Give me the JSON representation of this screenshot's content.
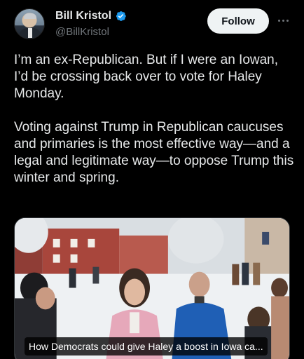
{
  "author": {
    "display_name": "Bill Kristol",
    "handle": "@BillKristol",
    "verified": true,
    "verified_color": "#1d9bf0",
    "avatar_icon": "profile-photo"
  },
  "actions": {
    "follow_label": "Follow",
    "more_icon": "ellipsis-icon"
  },
  "tweet": {
    "paragraphs": [
      "I’m an ex-Republican. But if I were an Iowan, I’d be crossing back over to vote for Haley Monday.",
      "Voting against Trump in Republican caucuses and primaries is the most effective way—and a legal and legitimate way—to oppose Trump this winter and spring."
    ]
  },
  "media": {
    "caption": "How Democrats could give Haley a boost in Iowa ca..."
  },
  "colors": {
    "background": "#000000",
    "text": "#e7e9ea",
    "secondary_text": "#71767b",
    "follow_button_bg": "#eff3f4"
  }
}
